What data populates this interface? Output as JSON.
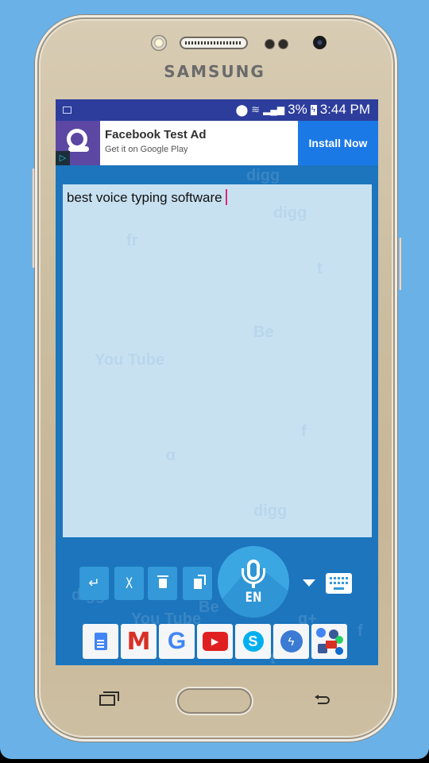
{
  "device": {
    "brand": "SAMSUNG",
    "frame_color": "#cbbd9f",
    "background_color": "#69b1e7"
  },
  "status_bar": {
    "left_icon": "image-notification-icon",
    "icons": [
      "location-icon",
      "wifi-icon",
      "signal-icon"
    ],
    "battery_percent": "3%",
    "battery_icon": "battery-charging-icon",
    "time": "3:44 PM",
    "color": "#2d3d9c"
  },
  "ad_banner": {
    "title": "Facebook Test Ad",
    "subtitle": "Get it on Google Play",
    "button_label": "Install Now",
    "adchoices_glyph": "▷",
    "button_color": "#1b79e6",
    "icon_color": "#5c47a3"
  },
  "editor": {
    "text": "best voice typing software",
    "background": "#c8e1f1",
    "caret_color": "#e0247a"
  },
  "controls": {
    "enter_glyph": "↵",
    "clear_label": "X",
    "delete_glyph": "🗑",
    "copy_glyph": "❐",
    "mic_language": "EN",
    "accent_color": "#3399d8"
  },
  "app_shortcuts": [
    {
      "name": "google-docs"
    },
    {
      "name": "gmail",
      "glyph": "M"
    },
    {
      "name": "google",
      "glyph": "G"
    },
    {
      "name": "youtube",
      "glyph": "▶"
    },
    {
      "name": "skype",
      "glyph": "S"
    },
    {
      "name": "messenger",
      "glyph": "ϟ"
    },
    {
      "name": "more-apps"
    }
  ],
  "background_pattern": [
    "digg",
    "You Tube",
    "fr",
    "Be",
    "t",
    "f",
    "α",
    "g+",
    "digg",
    "fr",
    "Be",
    "You Tube",
    "t",
    "f",
    "α",
    "digg"
  ]
}
